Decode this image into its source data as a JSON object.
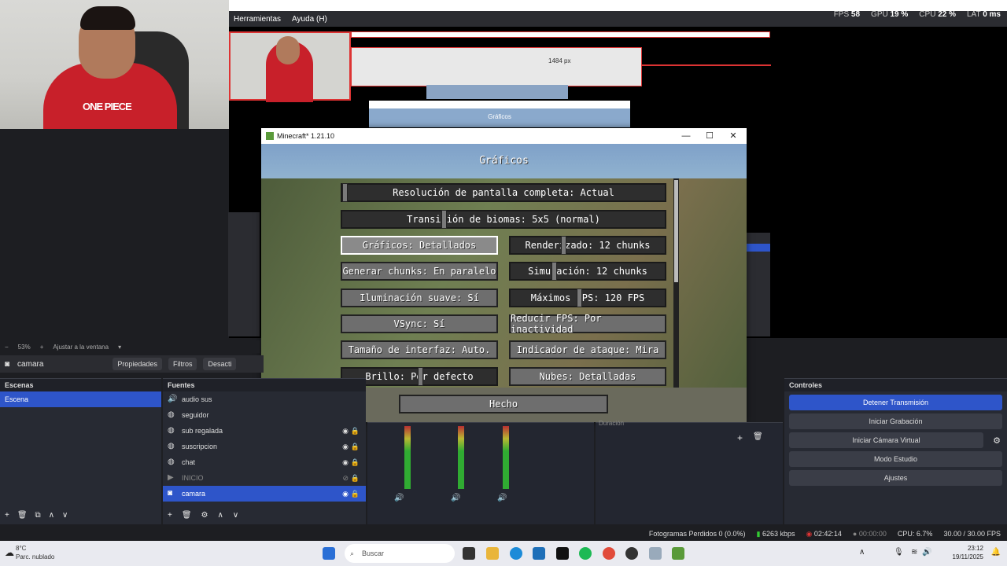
{
  "obs": {
    "menu": [
      "Herramientas",
      "Ayuda (H)"
    ],
    "stats": {
      "fps_label": "FPS",
      "fps_value": "58",
      "gpu_label": "GPU",
      "gpu_value": "19 %",
      "cpu_label": "CPU",
      "cpu_value": "22 %",
      "lat_label": "LAT",
      "lat_value": "0 ms"
    },
    "zoom": "53%",
    "fit_label": "Ajustar a la ventana",
    "selected_source": "camara",
    "toolbar": {
      "properties": "Propiedades",
      "filters": "Filtros",
      "deactivate": "Desacti"
    },
    "scenes": {
      "title": "Escenas",
      "items": [
        "Escena"
      ]
    },
    "sources": {
      "title": "Fuentes",
      "items": [
        {
          "label": "audio sus",
          "icon": "speaker-icon"
        },
        {
          "label": "seguidor",
          "icon": "globe-icon"
        },
        {
          "label": "sub regalada",
          "icon": "globe-icon"
        },
        {
          "label": "suscripcion",
          "icon": "globe-icon"
        },
        {
          "label": "chat",
          "icon": "globe-icon"
        },
        {
          "label": "INICIO",
          "icon": "play-icon"
        },
        {
          "label": "camara",
          "icon": "camera-icon"
        }
      ]
    },
    "controls": {
      "title": "Controles",
      "buttons": [
        "Detener Transmisión",
        "Iniciar Grabación",
        "Iniciar Cámara Virtual",
        "Modo Estudio",
        "Ajustes"
      ]
    },
    "duration_label": "Duración",
    "statusbar": {
      "dropped": "Fotogramas Perdidos 0 (0.0%)",
      "bitrate": "6263 kbps",
      "stream_time": "02:42:14",
      "rec_time": "00:00:00",
      "cpu": "CPU: 6.7%",
      "fps": "30.00 / 30.00 FPS"
    }
  },
  "preview_text": {
    "px": "1484 px",
    "graficos": "Gráficos"
  },
  "minecraft": {
    "window_title": "Minecraft* 1.21.10",
    "heading": "Gráficos",
    "buttons": {
      "fullscreen": "Resolución de pantalla completa: Actual",
      "biome": "Transición de biomas: 5x5 (normal)",
      "graphics": "Gráficos: Detallados",
      "render": "Renderizado: 12 chunks",
      "chunks": "Generar chunks: En paralelo",
      "simulation": "Simulación: 12 chunks",
      "smooth": "Iluminación suave: Sí",
      "maxfps": "Máximos FPS: 120 FPS",
      "vsync": "VSync: Sí",
      "reducefps": "Reducir FPS: Por inactividad",
      "gui": "Tamaño de interfaz: Auto.",
      "attack": "Indicador de ataque: Mira",
      "brightness": "Brillo: Por defecto",
      "clouds": "Nubes: Detalladas",
      "done": "Hecho"
    }
  },
  "taskbar": {
    "weather_temp": "8°C",
    "weather_desc": "Parc. nublado",
    "search_placeholder": "Buscar",
    "time": "23:12",
    "date": "19/11/2025"
  },
  "webcam": {
    "shirt_text": "ONE PIECE"
  }
}
